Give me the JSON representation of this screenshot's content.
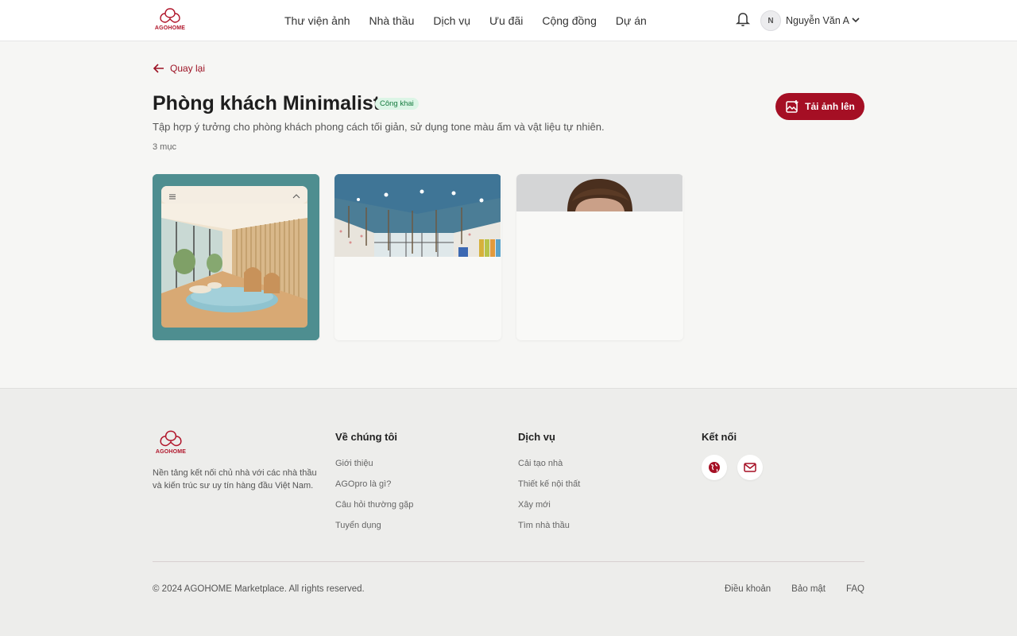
{
  "brand": {
    "name": "AGOHOME",
    "color": "#b0152a"
  },
  "nav": {
    "items": [
      "Thư viện ảnh",
      "Nhà thầu",
      "Dịch vụ",
      "Ưu đãi",
      "Cộng đồng",
      "Dự án"
    ]
  },
  "user": {
    "initial": "N",
    "name": "Nguyễn Văn A"
  },
  "icons": {
    "notification": "bell-icon",
    "menu": "chevron-down-icon",
    "back": "arrow-left-icon",
    "upload": "image-plus-icon",
    "social": [
      "globe-icon",
      "mail-icon"
    ]
  },
  "page": {
    "back_label": "Quay lại",
    "title": "Phòng khách Minimalist",
    "badge": "Công khai",
    "description": "Tập hợp ý tưởng cho phòng khách phong cách tối giản, sử dụng tone màu ấm và vật liệu tự nhiên.",
    "count": "3 mục",
    "upload_label": "Tải ảnh lên"
  },
  "gallery": [
    {
      "subject": "minimalist-room",
      "loaded": true
    },
    {
      "subject": "kids-room-ceiling",
      "loaded": "partial"
    },
    {
      "subject": "person-portrait",
      "loaded": "partial"
    }
  ],
  "footer": {
    "tagline": "Nền tảng kết nối chủ nhà với các nhà thầu và kiến trúc sư uy tín hàng đầu Việt Nam.",
    "columns": [
      {
        "heading": "Về chúng tôi",
        "links": [
          "Giới thiệu",
          "AGOpro là gì?",
          "Câu hỏi thường gặp",
          "Tuyển dụng"
        ]
      },
      {
        "heading": "Dịch vụ",
        "links": [
          "Cải tạo nhà",
          "Thiết kế nội thất",
          "Xây mới",
          "Tìm nhà thầu"
        ]
      },
      {
        "heading": "Kết nối",
        "links": []
      }
    ],
    "copyright": "© 2024 AGOHOME Marketplace. All rights reserved.",
    "bottom_links": [
      "Điều khoản",
      "Bảo mật",
      "FAQ"
    ]
  },
  "colors": {
    "accent": "#a50f24",
    "badge_bg": "#dcf5e6",
    "badge_text": "#157a3e"
  }
}
